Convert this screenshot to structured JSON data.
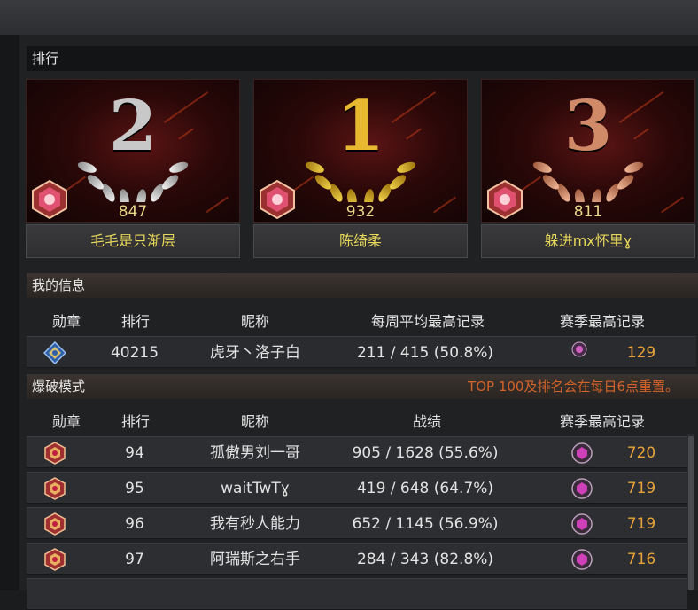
{
  "ranking": {
    "title": "排行",
    "podium": [
      {
        "place": "2",
        "score": "847",
        "name": "毛毛是只渐层",
        "color": "#c8c8c8"
      },
      {
        "place": "1",
        "score": "932",
        "name": "陈绮柔",
        "color": "#e8b830"
      },
      {
        "place": "3",
        "score": "811",
        "name": "躲进mx怀里ɣ",
        "color": "#d08a68"
      }
    ]
  },
  "my_info": {
    "title": "我的信息",
    "columns": [
      "勋章",
      "排行",
      "昵称",
      "每周平均最高记录",
      "赛季最高记录"
    ],
    "row": {
      "rank": "40215",
      "nickname": "虎牙丶洛子白",
      "record": "211 / 415 (50.8%)",
      "season_best": "129"
    }
  },
  "mode": {
    "title": "爆破模式",
    "notice": "TOP 100及排名会在每日6点重置。",
    "columns": [
      "勋章",
      "排行",
      "昵称",
      "战绩",
      "赛季最高记录"
    ],
    "rows": [
      {
        "rank": "94",
        "nickname": "孤傲男刘一哥",
        "record": "905 / 1628 (55.6%)",
        "season_best": "720"
      },
      {
        "rank": "95",
        "nickname": "waitTwTɣ",
        "record": "419 / 648 (64.7%)",
        "season_best": "719"
      },
      {
        "rank": "96",
        "nickname": "我有秒人能力",
        "record": "652 / 1145 (56.9%)",
        "season_best": "719"
      },
      {
        "rank": "97",
        "nickname": "阿瑞斯之右手",
        "record": "284 / 343 (82.8%)",
        "season_best": "716"
      }
    ]
  },
  "colors": {
    "accent_orange": "#d4632a",
    "value_gold": "#e8a23a",
    "name_yellow": "#e8d85a"
  }
}
